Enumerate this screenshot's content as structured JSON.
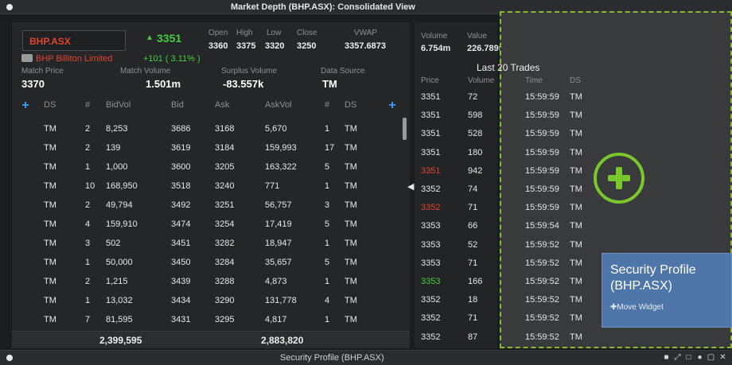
{
  "window": {
    "title": "Market Depth (BHP.ASX): Consolidated View"
  },
  "header": {
    "symbol": "BHP.ASX",
    "last_arrow": "▲",
    "last_price": "3351",
    "company": "BHP Billiton Limited",
    "change": "+101 ( 3.11% )",
    "open_label": "Open",
    "open": "3360",
    "high_label": "High",
    "high": "3375",
    "low_label": "Low",
    "low": "3320",
    "close_label": "Close",
    "close": "3250",
    "vwap_label": "VWAP",
    "vwap": "3357.6873",
    "match_price_label": "Match Price",
    "match_price": "3370",
    "match_volume_label": "Match Volume",
    "match_volume": "1.501m",
    "surplus_volume_label": "Surplus Volume",
    "surplus_volume": "-83.557k",
    "data_source_label": "Data Source",
    "data_source": "TM"
  },
  "depth": {
    "columns": [
      "DS",
      "#",
      "BidVol",
      "Bid",
      "Ask",
      "AskVol",
      "#",
      "DS"
    ],
    "rows": [
      [
        "TM",
        "2",
        "8,253",
        "3686",
        "3168",
        "5,670",
        "1",
        "TM"
      ],
      [
        "TM",
        "2",
        "139",
        "3619",
        "3184",
        "159,993",
        "17",
        "TM"
      ],
      [
        "TM",
        "1",
        "1,000",
        "3600",
        "3205",
        "163,322",
        "5",
        "TM"
      ],
      [
        "TM",
        "10",
        "168,950",
        "3518",
        "3240",
        "771",
        "1",
        "TM"
      ],
      [
        "TM",
        "2",
        "49,794",
        "3492",
        "3251",
        "56,757",
        "3",
        "TM"
      ],
      [
        "TM",
        "4",
        "159,910",
        "3474",
        "3254",
        "17,419",
        "5",
        "TM"
      ],
      [
        "TM",
        "3",
        "502",
        "3451",
        "3282",
        "18,947",
        "1",
        "TM"
      ],
      [
        "TM",
        "1",
        "50,000",
        "3450",
        "3284",
        "35,657",
        "5",
        "TM"
      ],
      [
        "TM",
        "2",
        "1,215",
        "3439",
        "3288",
        "4,873",
        "1",
        "TM"
      ],
      [
        "TM",
        "1",
        "13,032",
        "3434",
        "3290",
        "131,778",
        "4",
        "TM"
      ],
      [
        "TM",
        "7",
        "81,595",
        "3431",
        "3295",
        "4,817",
        "1",
        "TM"
      ]
    ],
    "total_bid_vol": "2,399,595",
    "total_ask_vol": "2,883,820"
  },
  "summary": {
    "volume_label": "Volume",
    "volume": "6.754m",
    "value_label": "Value",
    "value": "226.789m"
  },
  "trades": {
    "title": "Last 20 Trades",
    "columns": [
      "Price",
      "Volume",
      "Time",
      "DS"
    ],
    "rows": [
      {
        "price": "3351",
        "volume": "72",
        "time": "15:59:59",
        "ds": "TM",
        "color": "#e6e6e6"
      },
      {
        "price": "3351",
        "volume": "598",
        "time": "15:59:59",
        "ds": "TM",
        "color": "#e6e6e6"
      },
      {
        "price": "3351",
        "volume": "528",
        "time": "15:59:59",
        "ds": "TM",
        "color": "#e6e6e6"
      },
      {
        "price": "3351",
        "volume": "180",
        "time": "15:59:59",
        "ds": "TM",
        "color": "#e6e6e6"
      },
      {
        "price": "3351",
        "volume": "942",
        "time": "15:59:59",
        "ds": "TM",
        "color": "#e0452e"
      },
      {
        "price": "3352",
        "volume": "74",
        "time": "15:59:59",
        "ds": "TM",
        "color": "#e6e6e6"
      },
      {
        "price": "3352",
        "volume": "71",
        "time": "15:59:59",
        "ds": "TM",
        "color": "#e0452e"
      },
      {
        "price": "3353",
        "volume": "66",
        "time": "15:59:54",
        "ds": "TM",
        "color": "#e6e6e6"
      },
      {
        "price": "3353",
        "volume": "52",
        "time": "15:59:52",
        "ds": "TM",
        "color": "#e6e6e6"
      },
      {
        "price": "3353",
        "volume": "71",
        "time": "15:59:52",
        "ds": "TM",
        "color": "#e6e6e6"
      },
      {
        "price": "3353",
        "volume": "166",
        "time": "15:59:52",
        "ds": "TM",
        "color": "#3ecf3e"
      },
      {
        "price": "3352",
        "volume": "18",
        "time": "15:59:52",
        "ds": "TM",
        "color": "#e6e6e6"
      },
      {
        "price": "3352",
        "volume": "71",
        "time": "15:59:52",
        "ds": "TM",
        "color": "#e6e6e6"
      },
      {
        "price": "3352",
        "volume": "87",
        "time": "15:59:52",
        "ds": "TM",
        "color": "#e6e6e6"
      }
    ]
  },
  "widget": {
    "card_title_1": "Security Profile",
    "card_title_2": "(BHP.ASX)",
    "move_label": "Move Widget"
  },
  "bottom": {
    "title": "Security Profile (BHP.ASX)"
  },
  "colors": {
    "up": "#3ecf3e",
    "down": "#e0452e",
    "accent": "#7ac72c",
    "card": "#4f76a9"
  }
}
